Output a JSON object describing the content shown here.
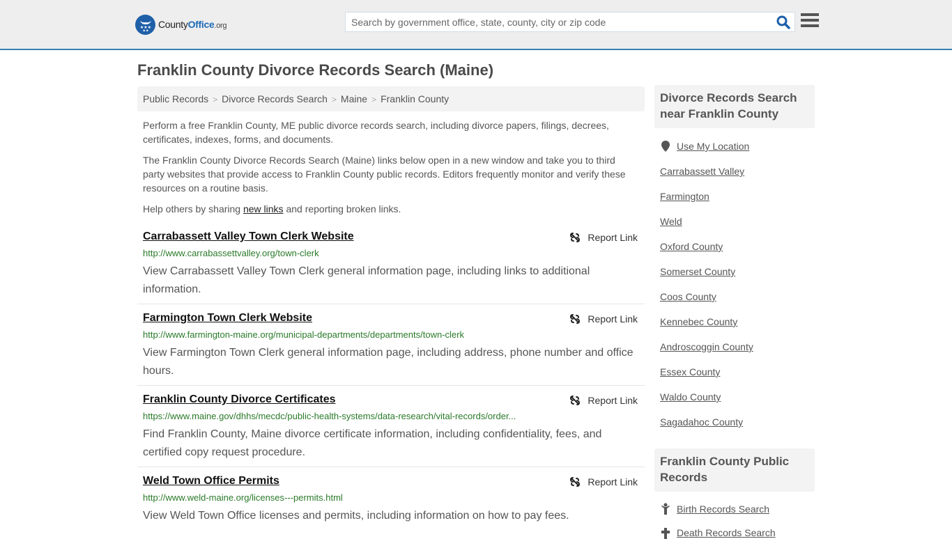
{
  "header": {
    "logo": {
      "text_main": "County",
      "text_accent": "Office",
      "text_suffix": ".org",
      "icon": "eagle-stars-badge-icon"
    },
    "search": {
      "placeholder": "Search by government office, state, county, city or zip code",
      "value": "",
      "icon": "search-icon"
    },
    "menu_icon": "hamburger-menu-icon"
  },
  "page": {
    "title": "Franklin County Divorce Records Search (Maine)"
  },
  "breadcrumb": [
    {
      "label": "Public Records"
    },
    {
      "label": "Divorce Records Search"
    },
    {
      "label": "Maine"
    },
    {
      "label": "Franklin County"
    }
  ],
  "breadcrumb_separator": ">",
  "intro": {
    "p1": "Perform a free Franklin County, ME public divorce records search, including divorce papers, filings, decrees, certificates, indexes, forms, and documents.",
    "p2": "The Franklin County Divorce Records Search (Maine) links below open in a new window and take you to third party websites that provide access to Franklin County public records. Editors frequently monitor and verify these resources on a routine basis.",
    "p3_before": "Help others by sharing ",
    "p3_link": "new links",
    "p3_after": " and reporting broken links."
  },
  "report_label": "Report Link",
  "results": [
    {
      "title": "Carrabassett Valley Town Clerk Website",
      "url": "http://www.carrabassettvalley.org/town-clerk",
      "description": "View Carrabassett Valley Town Clerk general information page, including links to additional information."
    },
    {
      "title": "Farmington Town Clerk Website",
      "url": "http://www.farmington-maine.org/municipal-departments/departments/town-clerk",
      "description": "View Farmington Town Clerk general information page, including address, phone number and office hours."
    },
    {
      "title": "Franklin County Divorce Certificates",
      "url": "https://www.maine.gov/dhhs/mecdc/public-health-systems/data-research/vital-records/order...",
      "description": "Find Franklin County, Maine divorce certificate information, including confidentiality, fees, and certified copy request procedure."
    },
    {
      "title": "Weld Town Office Permits",
      "url": "http://www.weld-maine.org/licenses---permits.html",
      "description": "View Weld Town Office licenses and permits, including information on how to pay fees."
    }
  ],
  "sidebar": {
    "nearby_heading": "Divorce Records Search near Franklin County",
    "use_location": "Use My Location",
    "nearby_links": [
      "Carrabassett Valley",
      "Farmington",
      "Weld",
      "Oxford County",
      "Somerset County",
      "Coos County",
      "Kennebec County",
      "Androscoggin County",
      "Essex County",
      "Waldo County",
      "Sagadahoc County"
    ],
    "public_records_heading": "Franklin County Public Records",
    "public_records_links": [
      {
        "label": "Birth Records Search",
        "icon": "baby-icon"
      },
      {
        "label": "Death Records Search",
        "icon": "cross-icon"
      }
    ]
  },
  "colors": {
    "brand_blue": "#1e5fa8",
    "header_border": "#3a7fb0",
    "url_green": "#2a7a2a",
    "search_icon": "#1e5fa8"
  }
}
